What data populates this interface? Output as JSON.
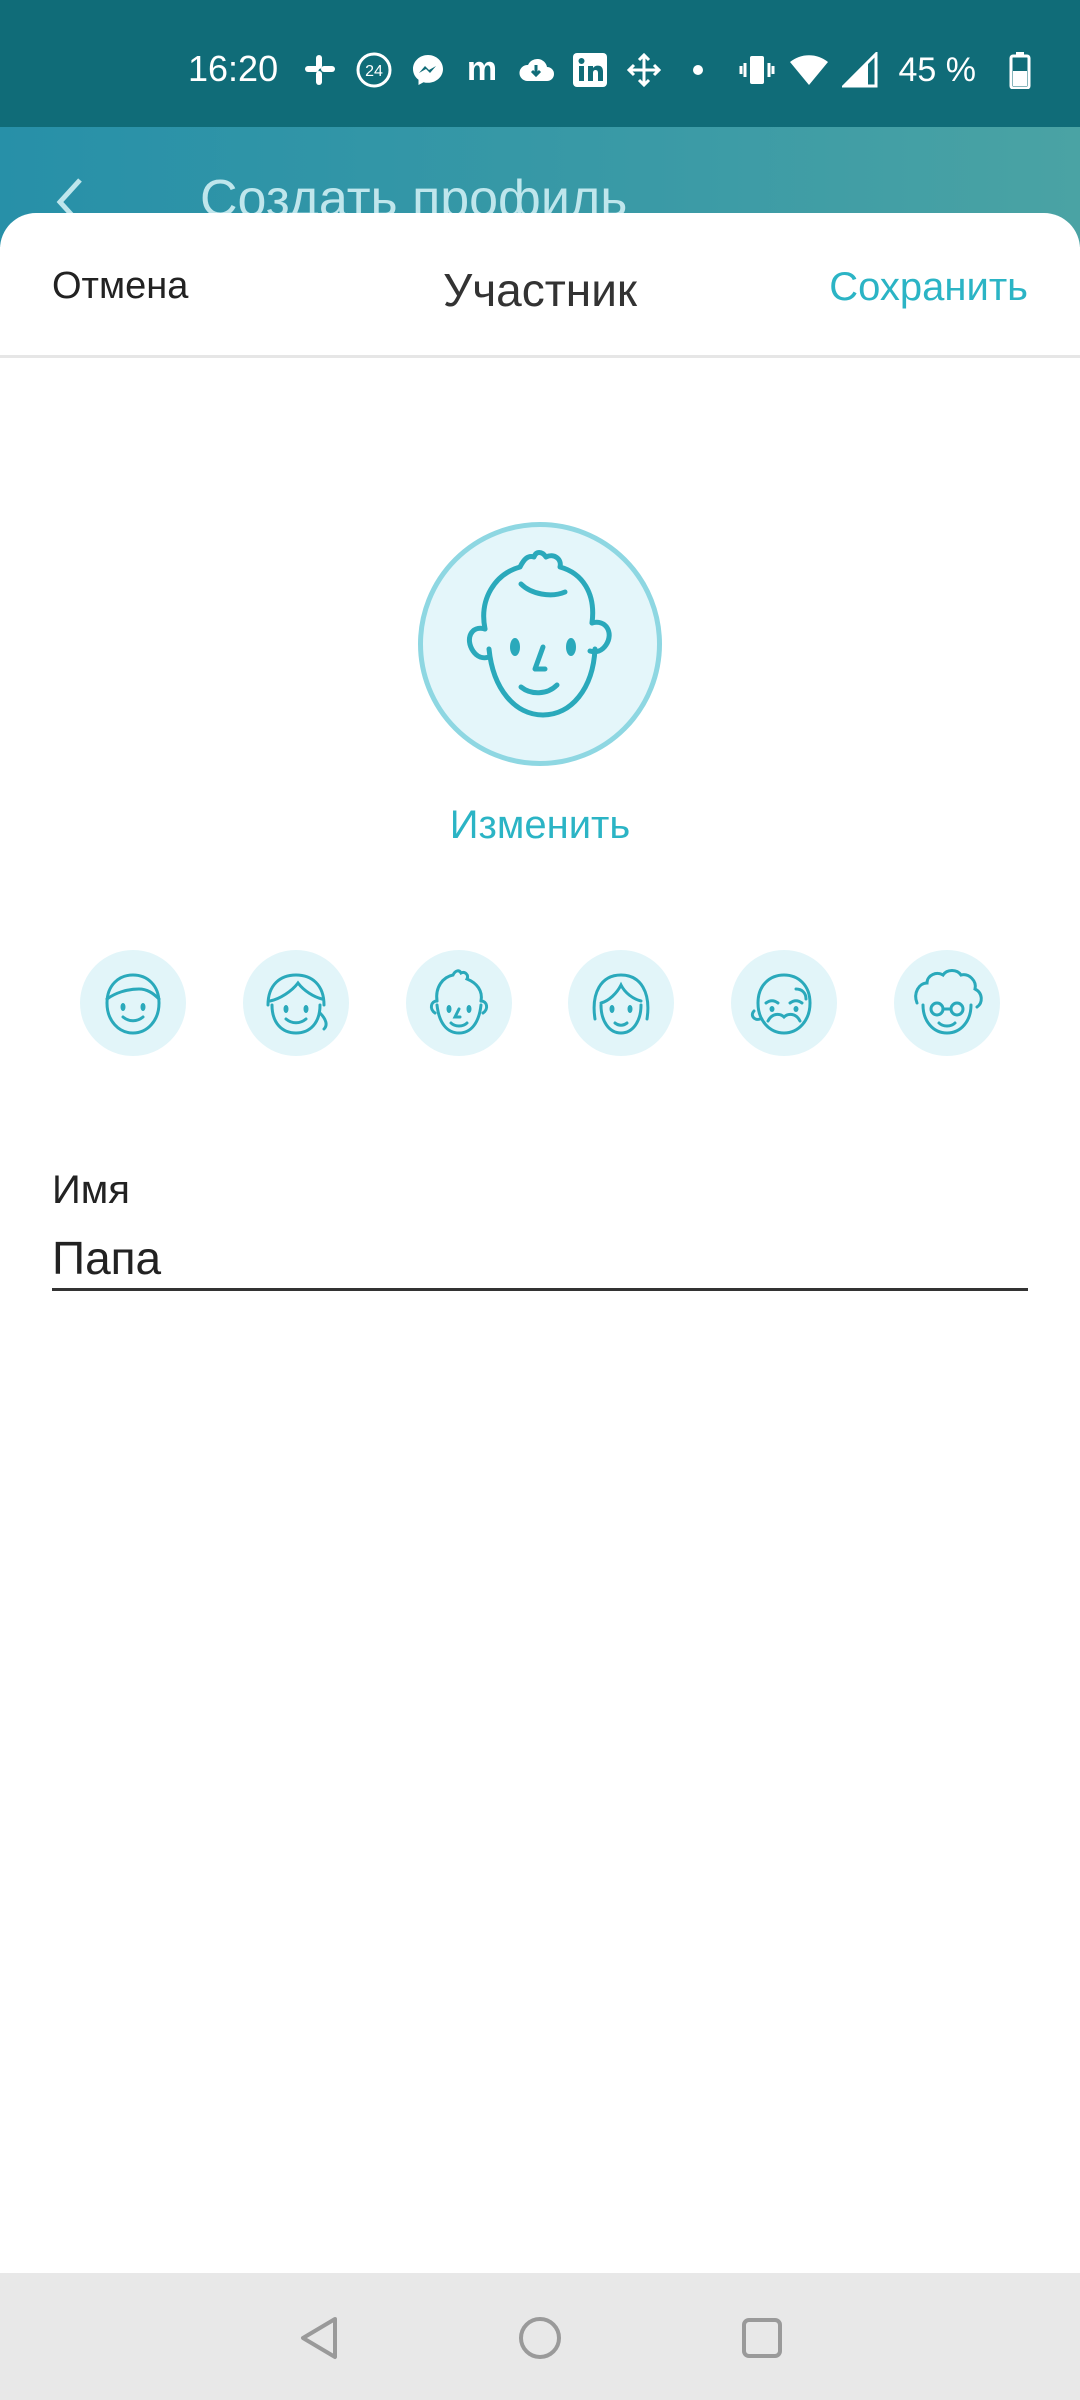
{
  "status_bar": {
    "time": "16:20",
    "battery_percent": "45 %",
    "left_icons": [
      "slack-icon",
      "badge-24-icon",
      "messenger-icon",
      "medium-icon",
      "cloud-icon",
      "linkedin-icon",
      "move-icon",
      "dot-icon"
    ],
    "right_icons": [
      "vibrate-icon",
      "wifi-icon",
      "signal-icon",
      "battery-icon"
    ]
  },
  "background_screen": {
    "title": "Создать профиль"
  },
  "sheet": {
    "cancel_label": "Отмена",
    "title": "Участник",
    "save_label": "Сохранить",
    "change_label": "Изменить",
    "avatar_options": [
      "boy-avatar",
      "girl-avatar",
      "young-man-avatar",
      "woman-avatar",
      "grandpa-avatar",
      "grandma-avatar"
    ],
    "name_label": "Имя",
    "name_value": "Папа"
  },
  "colors": {
    "accent": "#2bb4c5",
    "status_bar": "#106c78",
    "avatar_bg": "#e4f6fa"
  }
}
